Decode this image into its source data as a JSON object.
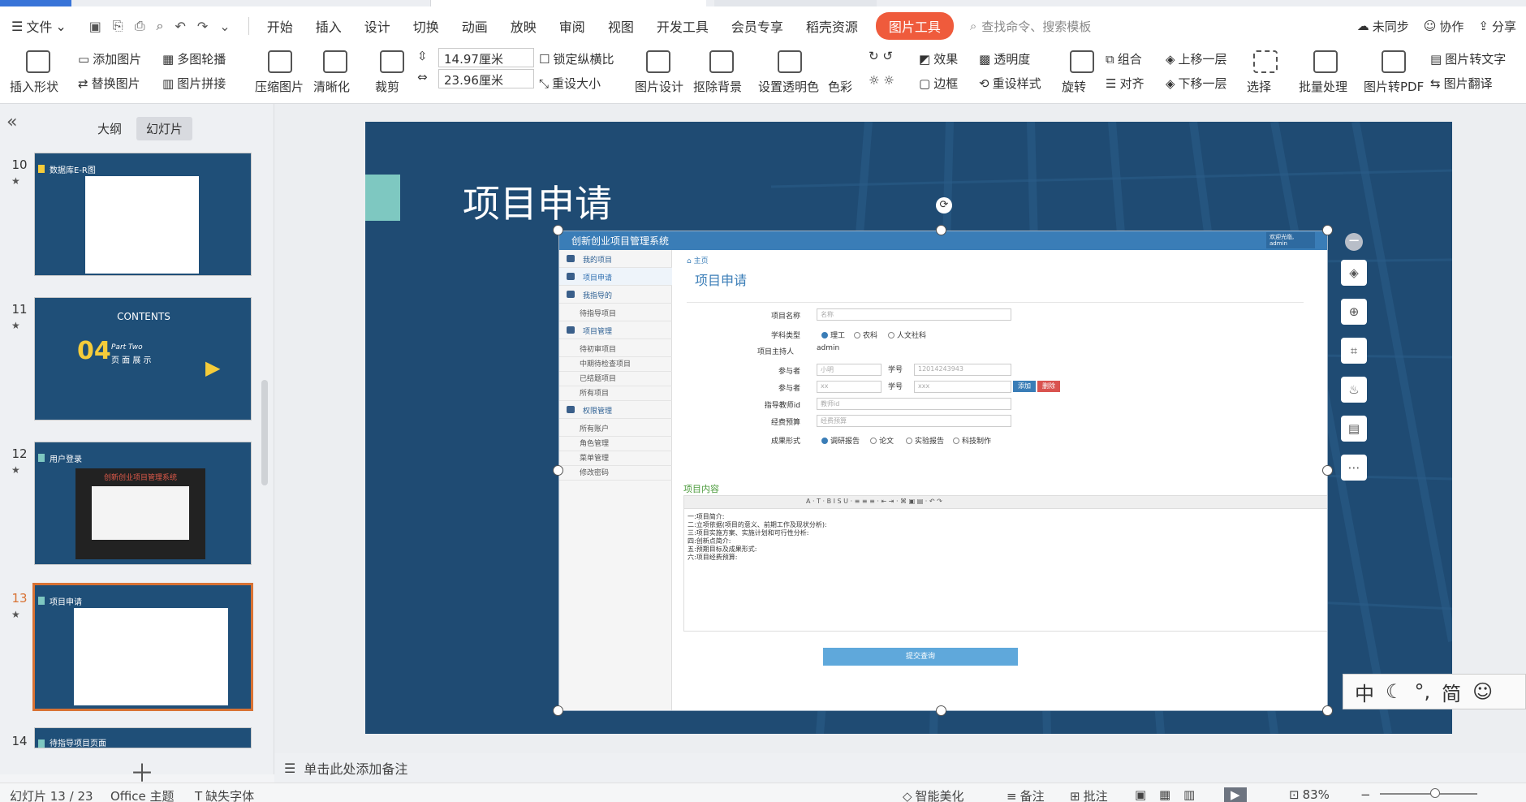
{
  "window": {
    "menu_file": "文件",
    "tabs": [
      "开始",
      "插入",
      "设计",
      "切换",
      "动画",
      "放映",
      "审阅",
      "视图",
      "开发工具",
      "会员专享",
      "稻壳资源"
    ],
    "tool_tab": "图片工具",
    "search_placeholder": "查找命令、搜索模板",
    "sync": "未同步",
    "collab": "协作",
    "share": "分享"
  },
  "ribbon": {
    "insert_shape": "插入形状",
    "add_image": "添加图片",
    "multi_carousel": "多图轮播",
    "replace_image": "替换图片",
    "image_stitch": "图片拼接",
    "compress": "压缩图片",
    "sharpen": "清晰化",
    "crop": "裁剪",
    "width": "14.97厘米",
    "height": "23.96厘米",
    "lock_ratio": "锁定纵横比",
    "reset_size": "重设大小",
    "image_design": "图片设计",
    "remove_bg": "抠除背景",
    "set_transparent": "设置透明色",
    "color": "色彩",
    "effect": "效果",
    "transparency": "透明度",
    "border": "边框",
    "reset_style": "重设样式",
    "rotate": "旋转",
    "group": "组合",
    "align": "对齐",
    "bring_forward": "上移一层",
    "send_backward": "下移一层",
    "select": "选择",
    "batch": "批量处理",
    "to_pdf": "图片转PDF",
    "to_text": "图片转文字",
    "translate": "图片翻译"
  },
  "left_panel": {
    "tab_outline": "大纲",
    "tab_slides": "幻灯片",
    "thumbs": [
      {
        "num": "10",
        "title": "数据库E-R图"
      },
      {
        "num": "11",
        "title": "CONTENTS",
        "sub_num": "04",
        "sub_a": "Part Two",
        "sub_b": "页 面 展 示"
      },
      {
        "num": "12",
        "title": "用户登录",
        "inner_title": "创新创业项目管理系统"
      },
      {
        "num": "13",
        "title": "项目申请"
      },
      {
        "num": "14",
        "title": "待指导项目页面"
      }
    ]
  },
  "slide": {
    "title": "项目申请"
  },
  "app_shot": {
    "header": "创新创业项目管理系统",
    "welcome": "欢迎光临,",
    "user": "admin",
    "crumb": "主页",
    "page_title": "项目申请",
    "sidebar": [
      "我的项目",
      "项目申请",
      "我指导的",
      "待指导项目",
      "项目管理",
      "待初审项目",
      "中期待检查项目",
      "已结题项目",
      "所有项目",
      "权限管理",
      "所有账户",
      "角色管理",
      "菜单管理",
      "修改密码"
    ],
    "labels": {
      "name": "项目名称",
      "subject": "学科类型",
      "host": "项目主持人",
      "member": "参与者",
      "stuno": "学号",
      "teacher": "指导教师id",
      "budget": "经费预算",
      "form": "成果形式"
    },
    "placeholders": {
      "name": "名称",
      "member1": "小明",
      "stuno1": "12014243943",
      "member2": "xx",
      "stuno2": "xxx",
      "teacher": "教师id",
      "budget": "经费预算"
    },
    "host_value": "admin",
    "subjects": [
      "理工",
      "农科",
      "人文社科"
    ],
    "forms": [
      "调研报告",
      "论文",
      "实验报告",
      "科技制作"
    ],
    "btn_add": "添加",
    "btn_del": "删除",
    "content_title": "项目内容",
    "editor_lines": [
      "一:项目简介:",
      "二:立项依据(项目的意义、前期工作及现状分析):",
      "三:项目实施方案、实施计划和可行性分析:",
      "四:创新点简介:",
      "五:预期目标及成果形式:",
      "六:项目经费预算:"
    ],
    "submit": "提交查询"
  },
  "ime": {
    "lang": "中",
    "mode": "简"
  },
  "notes": "单击此处添加备注",
  "status": {
    "slide_no": "幻灯片 13 / 23",
    "theme": "Office 主题",
    "missing_font": "缺失字体",
    "beautify": "智能美化",
    "notes_btn": "备注",
    "comment": "批注",
    "zoom": "83%"
  }
}
